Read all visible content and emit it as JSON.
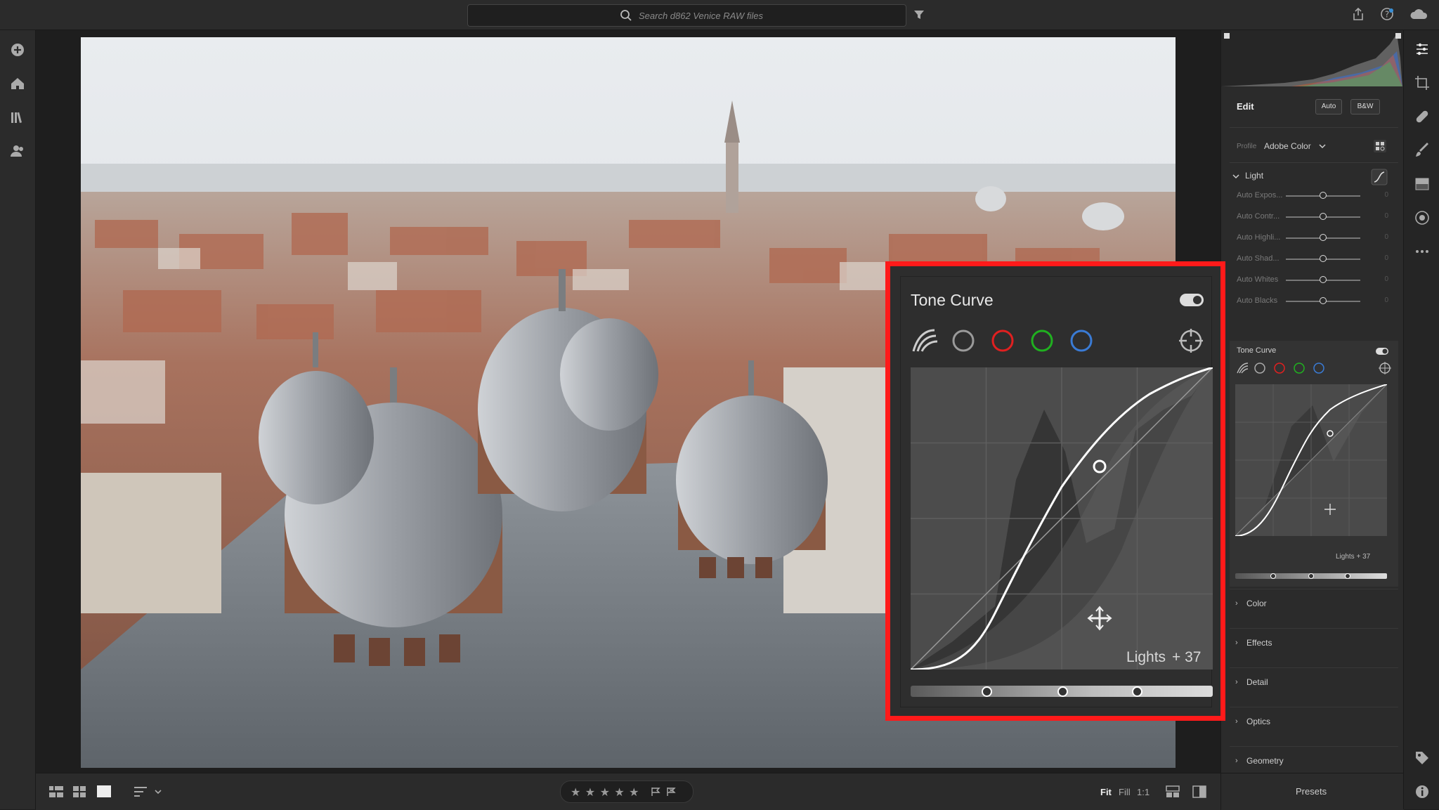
{
  "search": {
    "placeholder": "Search d862 Venice RAW files"
  },
  "edit_panel": {
    "title": "Edit",
    "auto_label": "Auto",
    "bw_label": "B&W",
    "profile_label": "Profile",
    "profile_value": "Adobe Color",
    "light_section": {
      "title": "Light",
      "sliders": [
        {
          "name": "Auto Expos...",
          "value": "0"
        },
        {
          "name": "Auto Contr...",
          "value": "0"
        },
        {
          "name": "Auto Highli...",
          "value": "0"
        },
        {
          "name": "Auto Shad...",
          "value": "0"
        },
        {
          "name": "Auto Whites",
          "value": "0"
        },
        {
          "name": "Auto Blacks",
          "value": "0"
        }
      ]
    },
    "tone_curve_small": {
      "title": "Tone Curve",
      "readout": "Lights  + 37"
    },
    "sections": [
      "Color",
      "Effects",
      "Detail",
      "Optics",
      "Geometry"
    ]
  },
  "tone_curve": {
    "title": "Tone Curve",
    "region_label": "Lights",
    "region_value": "+ 37",
    "channels": [
      "parametric",
      "point",
      "red",
      "green",
      "blue"
    ],
    "channel_colors": {
      "point": "#9a9a9a",
      "red": "#e02020",
      "green": "#20b020",
      "blue": "#3a7bd5"
    },
    "accent_color": "#ff1a1a"
  },
  "bottom": {
    "stars": "★ ★ ★ ★ ★",
    "fit": "Fit",
    "fill": "Fill",
    "one_to_one": "1:1",
    "presets": "Presets"
  }
}
